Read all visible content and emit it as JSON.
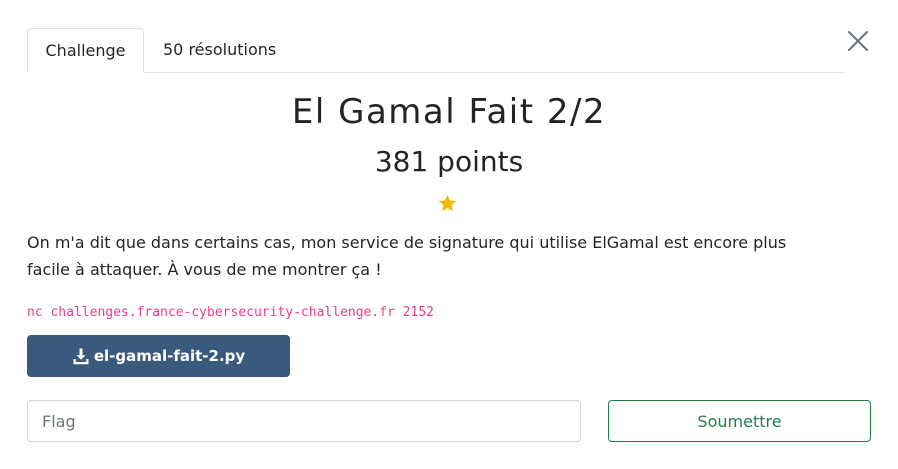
{
  "tabs": [
    {
      "label": "Challenge",
      "active": true
    },
    {
      "label": "50 résolutions",
      "active": false
    }
  ],
  "challenge": {
    "title": "El Gamal Fait 2/2",
    "points": "381 points",
    "difficulty_stars": 1,
    "description": "On m'a dit que dans certains cas, mon service de signature qui utilise ElGamal est encore plus facile à attaquer. À vous de me montrer ça !",
    "command": "nc challenges.france-cybersecurity-challenge.fr 2152",
    "file": "el-gamal-fait-2.py"
  },
  "flag_form": {
    "placeholder": "Flag",
    "value": "",
    "submit_label": "Soumettre"
  },
  "colors": {
    "download_button": "#3a5a7d",
    "submit_accent": "#1e7e4a",
    "command_text": "#e83e8c",
    "star": "#f5b800"
  },
  "icons": {
    "close": "close-icon",
    "star": "star-icon",
    "download": "download-icon"
  }
}
